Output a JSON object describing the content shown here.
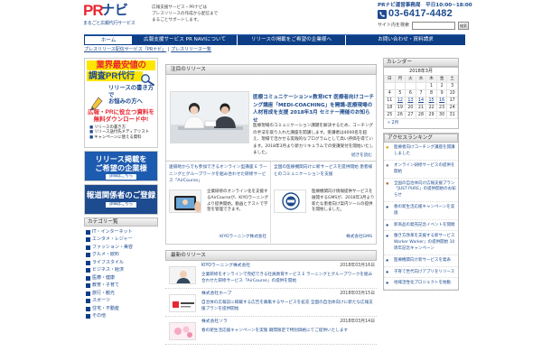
{
  "header": {
    "logo_pr": "PR",
    "logo_navi": "ナビ",
    "logo_tagline": "まるごと広報代行サービス",
    "description_lines": [
      "広報支援サービス・PRナビは",
      "プレスリリースの作成から配信まで",
      "まるごとサポートします。"
    ],
    "business_hours": "PRナビ運営事務局　平日10:00~18:00",
    "phone": "03-6417-4482",
    "search_label": "サイト内を検索",
    "search_placeholder": "",
    "search_button": "検索"
  },
  "nav": {
    "items": [
      {
        "label": "ホーム",
        "active": true
      },
      {
        "label": "広報支援サービス PR NAVIについて",
        "active": false
      },
      {
        "label": "リリースの掲載をご希望の企業様へ",
        "active": false
      },
      {
        "label": "お問い合わせ・資料請求",
        "active": false
      }
    ]
  },
  "breadcrumb": {
    "items": [
      "プレスリリース配信サービス「PRナビ」",
      "プレスリリース一覧"
    ]
  },
  "left": {
    "banner_cheapest": {
      "line1": "業界最安値の",
      "line2": "調査PR代行",
      "line3a": "リリースの書き方で",
      "line3b": "お悩みの方へ",
      "line4a": "広報・PRに役立つ資料を",
      "line4b": "無料ダウンロード中!",
      "list": [
        "リリースの書き方",
        "リリース送付先メディアリスト",
        "キャンペーンに使える資料"
      ]
    },
    "banner_request": {
      "line1": "リリース掲載を",
      "line2": "ご希望の企業様",
      "detail": "詳細はこちら"
    },
    "banner_reporter": {
      "line1": "報道関係者のご登録",
      "detail": "詳細はこちら"
    },
    "category_title": "カテゴリー覧",
    "categories": [
      "IT・インターネット",
      "エンタメ・レジャー",
      "ファッション・美容",
      "グルメ・飲料",
      "ライフスタイル",
      "ビジネス・経済",
      "医療・健康",
      "教育・子育て",
      "旅行・観光",
      "スポーツ",
      "住宅・不動産",
      "その他"
    ]
  },
  "main": {
    "pickup_title": "注目のリリース",
    "feature": {
      "title": "医療コミュニケーション×教育ICT 医療者向けコーチング講座「MEDI-COACHING」を開講-医療現場の人材育成を支援 2018年3月 セミナー開催のお知らせ",
      "body": "医療現場のコミュニケーション課題を解決するため、コーチングの手法を取り入れた講座を開講します。受講者は4000名を超え、現場で活かせる実践的なプログラムとして高い評価を得ています。2018年3月より新カリキュラムでの受講受付を開始いたしました。",
      "more": "続きを読む"
    },
    "pair": [
      {
        "title": "遠隔地からでも参加できるオンライン型講座 E ラーニングとグループワークを組み合わせた研修サービス「AirCourse」",
        "desc": "企業研修のオンライン化を支援するAirCourseが、KIYOラーニングより提供開始。動画とテストで学習を管理できます。",
        "company": "KIYOラーニング株式会社"
      },
      {
        "title": "全国の医療機関向けに新サービスを提供開始 患者様とのコミュニケーションを支援",
        "desc": "医療機関向け情報提供サービスを展開するGMSが、2018年3月より新たな患者向け案内ツールの提供を開始しました。",
        "company": "株式会社GMS"
      }
    ],
    "latest_title": "最新のリリース",
    "releases": [
      {
        "company": "KIYOラーニング株式会社",
        "date": "2018年03月16日",
        "title": "企業研修をオンラインで完結できる社員教育サービス E ラーニングとグループワークを組み合わせた研修サービス「AirCourse」の提供を開始"
      },
      {
        "company": "株式会社ホープ",
        "date": "2018年03月15日",
        "title": "自治体の広報誌に掲載する広告を募集するサービスを拡充 全国の自治体向けに新たな広報支援プランを提供開始"
      },
      {
        "company": "株式会社ソラ",
        "date": "2018年03月14日",
        "title": "春の新生活応援キャンペーンを実施 期間限定で特別価格にてご提供いたします"
      }
    ]
  },
  "right": {
    "calendar_title": "カレンダー",
    "calendar_caption": "2018年3月",
    "weekdays": [
      "日",
      "月",
      "火",
      "水",
      "木",
      "金",
      "土"
    ],
    "weeks": [
      [
        "",
        "",
        "",
        "",
        "1",
        "2",
        "3"
      ],
      [
        "4",
        "5",
        "6",
        "7",
        "8",
        "9",
        "10"
      ],
      [
        "11",
        "12",
        "13",
        "14",
        "15",
        "16",
        "17"
      ],
      [
        "18",
        "19",
        "20",
        "21",
        "22",
        "23",
        "24"
      ],
      [
        "25",
        "26",
        "27",
        "28",
        "29",
        "30",
        "31"
      ]
    ],
    "linked_days": [
      "12",
      "13",
      "14",
      "15",
      "16"
    ],
    "calendar_prev": "« 2月",
    "ranking_title": "アクセスランキング",
    "ranking": [
      "医療者向けコーチング講座を開講しました",
      "オンライン研修サービスの提供を開始",
      "全国の自治体向け広報支援プラン 「JUST PURE」の提供開始のお知らせ",
      "春の新生活応援キャンペーンを実施",
      "新商品の発売記念イベントを開催",
      "働き方改革を支援する新サービス Worker Worker」の提供開始 10 周年記念キャンペーン",
      "医療機関向け新サービスを発表",
      "子育て世代向けアプリをリリース",
      "地域活性化プロジェクトを始動"
    ]
  }
}
